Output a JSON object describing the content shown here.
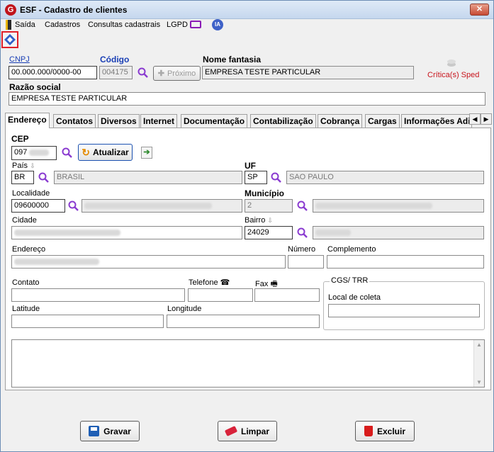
{
  "window": {
    "title": "ESF - Cadastro de clientes",
    "close_label": "✕",
    "app_icon": "G"
  },
  "menu": {
    "items": [
      "Saída",
      "Cadastros",
      "Consultas cadastrais",
      "LGPD"
    ],
    "ia_label": "IA"
  },
  "header": {
    "cnpj_label": "CNPJ",
    "cnpj_value": "00.000.000/0000-00",
    "codigo_label": "Código",
    "codigo_value": "004175",
    "proximo_label": "Próximo",
    "nome_fantasia_label": "Nome fantasia",
    "nome_fantasia_value": "EMPRESA TESTE PARTICULAR",
    "sped_label": "Crítica(s) Sped",
    "razao_social_label": "Razão social",
    "razao_social_value": "EMPRESA TESTE PARTICULAR"
  },
  "tabs": [
    "Endereço",
    "Contatos",
    "Diversos",
    "Internet",
    "Documentação",
    "Contabilização",
    "Cobrança",
    "Cargas",
    "Informações Adi"
  ],
  "address": {
    "cep_label": "CEP",
    "cep_value": "097",
    "atualizar_label": "Atualizar",
    "pais_label": "País",
    "pais_code": "BR",
    "pais_name": "BRASIL",
    "uf_label": "UF",
    "uf_code": "SP",
    "uf_name": "SAO PAULO",
    "localidade_label": "Localidade",
    "localidade_value": "09600000",
    "municipio_label": "Município",
    "municipio_value": "2",
    "cidade_label": "Cidade",
    "bairro_label": "Bairro",
    "bairro_value": "24029",
    "endereco_label": "Endereço",
    "numero_label": "Número",
    "complemento_label": "Complemento",
    "contato_label": "Contato",
    "telefone_label": "Telefone",
    "fax_label": "Fax",
    "latitude_label": "Latitude",
    "longitude_label": "Longitude",
    "cgs_label": "CGS/ TRR",
    "local_coleta_label": "Local de coleta"
  },
  "actions": {
    "gravar": "Gravar",
    "limpar": "Limpar",
    "excluir": "Excluir"
  }
}
